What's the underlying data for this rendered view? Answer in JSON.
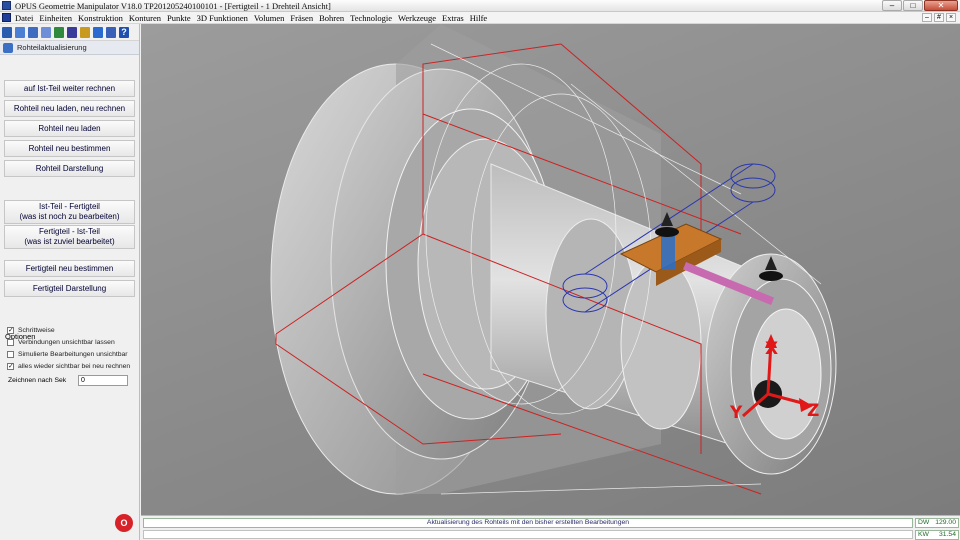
{
  "window": {
    "title": "OPUS Geometrie Manipulator V18.0   TP201205240100101  - [Fertigteil - 1 Drehteil Ansicht]",
    "controls": [
      "–",
      "□",
      "✕"
    ]
  },
  "menubar": {
    "items": [
      "Datei",
      "Einheiten",
      "Konstruktion",
      "Konturen",
      "Punkte",
      "3D Funktionen",
      "Volumen",
      "Fräsen",
      "Bohren",
      "Technologie",
      "Werkzeuge",
      "Extras",
      "Hilfe"
    ],
    "mdi_controls": [
      "–",
      "#",
      "×"
    ]
  },
  "toolbar": {
    "icons": [
      {
        "name": "tree-icon",
        "color": "#2a5db0"
      },
      {
        "name": "part-icon",
        "color": "#4a7fd4"
      },
      {
        "name": "grid-icon",
        "color": "#3d6cc0"
      },
      {
        "name": "document-icon",
        "color": "#6e8fd8"
      },
      {
        "name": "shape-icon",
        "color": "#2f8a3d"
      },
      {
        "name": "dimension-icon",
        "color": "#3b3b9a"
      },
      {
        "name": "tool-icon",
        "color": "#c99a20"
      },
      {
        "name": "magic-wand-icon",
        "color": "#2a6ad0"
      },
      {
        "name": "settings-icon",
        "color": "#3a5fb8"
      },
      {
        "name": "help-icon",
        "color": "#1e4fb0"
      }
    ]
  },
  "panel": {
    "header": "Rohteilaktualisierung",
    "buttons": {
      "b1": "auf Ist-Teil weiter rechnen",
      "b2": "Rohteil neu laden, neu rechnen",
      "b3": "Rohteil neu laden",
      "b4": "Rohteil neu bestimmen",
      "b5": "Rohteil Darstellung",
      "b6_line1": "Ist-Teil - Fertigteil",
      "b6_line2": "(was ist noch zu bearbeiten)",
      "b7_line1": "Fertigteil - Ist-Teil",
      "b7_line2": "(was ist zuviel bearbeitet)",
      "b8": "Fertigteil neu bestimmen",
      "b9": "Fertigteil Darstellung"
    },
    "options_label": "Optionen",
    "options": [
      {
        "label": "Schrittweise",
        "checked": true
      },
      {
        "label": "Verbindungen unsichtbar lassen",
        "checked": false
      },
      {
        "label": "Simulierte Bearbeitungen unsichtbar",
        "checked": false
      },
      {
        "label": "alles wieder sichtbar bei neu rechnen",
        "checked": true
      }
    ],
    "zeichnen_label": "Zeichnen nach Sek",
    "zeichnen_value": "0"
  },
  "viewport": {
    "axis_labels": {
      "x": "X",
      "y": "Y",
      "z": "Z"
    }
  },
  "status": {
    "message": "Aktualisierung des Rohteils mit den bisher erstellten Bearbeitungen",
    "dw_label": "DW",
    "dw_value": "129.00",
    "kw_label": "KW",
    "kw_value": "31.54"
  },
  "logo_text": "O",
  "colors": {
    "viewport_bg": "#8e8e8e",
    "stock_outline": "#cc2222",
    "toolpath": "#2a36b0",
    "tool_orange": "#c8782a",
    "axis_red": "#e01818"
  }
}
